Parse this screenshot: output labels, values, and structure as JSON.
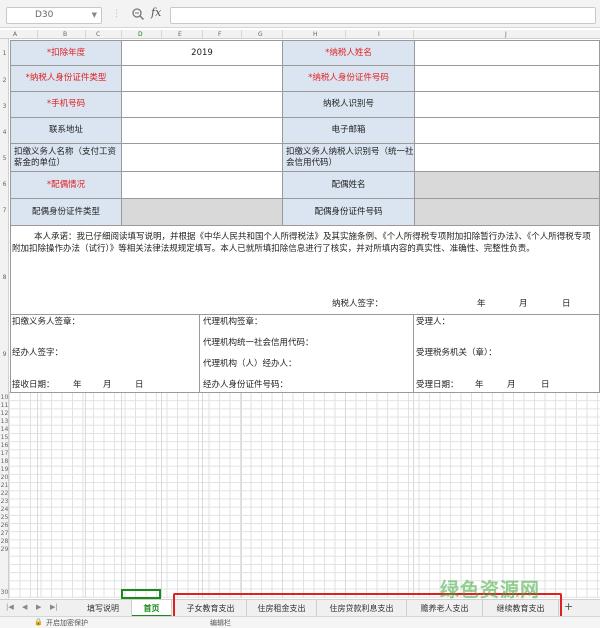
{
  "formula_bar": {
    "cell_ref": "D30",
    "fx_label": "fx",
    "formula_value": ""
  },
  "columns": [
    "A",
    "B",
    "C",
    "D",
    "E",
    "F",
    "G",
    "H",
    "I",
    "J"
  ],
  "rows": [
    "1",
    "2",
    "3",
    "4",
    "5",
    "6",
    "7",
    "8",
    "9",
    "10",
    "11",
    "12",
    "13",
    "14",
    "15",
    "16",
    "17",
    "18",
    "19",
    "20",
    "21",
    "22",
    "23",
    "24",
    "25",
    "26",
    "27",
    "28",
    "29",
    "30"
  ],
  "form": {
    "deduction_year_label": "*扣除年度",
    "deduction_year_value": "2019",
    "taxpayer_name_label": "*纳税人姓名",
    "id_type_label": "*纳税人身份证件类型",
    "id_number_label": "*纳税人身份证件号码",
    "phone_label": "*手机号码",
    "taxpayer_id_label": "纳税人识别号",
    "address_label": "联系地址",
    "email_label": "电子邮箱",
    "withholder_name_label": "扣缴义务人名称（支付工资薪金的单位）",
    "withholder_id_label": "扣缴义务人纳税人识别号（统一社会信用代码）",
    "spouse_status_label": "*配偶情况",
    "spouse_name_label": "配偶姓名",
    "spouse_id_type_label": "配偶身份证件类型",
    "spouse_id_number_label": "配偶身份证件号码",
    "promise_text": "本人承诺：我已仔细阅读填写说明，并根据《中华人民共和国个人所得税法》及其实施条例、《个人所得税专项附加扣除暂行办法》、《个人所得税专项附加扣除操作办法（试行）》等相关法律法规规定填写。本人已就所填扣除信息进行了核实，并对所填内容的真实性、准确性、完整性负责。",
    "taxpayer_signature_label": "纳税人签字：",
    "year_char": "年",
    "month_char": "月",
    "day_char": "日",
    "withholder_seal_label": "扣缴义务人签章：",
    "handler_signature_label": "经办人签字：",
    "receive_date_label": "接收日期：",
    "agent_seal_label": "代理机构签章：",
    "agent_credit_code_label": "代理机构统一社会信用代码：",
    "agent_handler_label": "代理机构（人）经办人：",
    "handler_id_label": "经办人身份证件号码：",
    "acceptor_label": "受理人：",
    "tax_office_label": "受理税务机关（章）：",
    "accept_date_label": "受理日期："
  },
  "tabs": [
    {
      "label": "填写说明",
      "active": false
    },
    {
      "label": "首页",
      "active": true
    },
    {
      "label": "子女教育支出",
      "active": false
    },
    {
      "label": "住房租金支出",
      "active": false
    },
    {
      "label": "住房贷款利息支出",
      "active": false
    },
    {
      "label": "赡养老人支出",
      "active": false
    },
    {
      "label": "继续教育支出",
      "active": false
    }
  ],
  "status": {
    "left_text": "开启加密保护",
    "mid_text": "编辑栏"
  },
  "watermark": {
    "main": "绿色资源网"
  },
  "colors": {
    "label_fill": "#dbe5f1",
    "disabled_fill": "#d9d9d9",
    "required_red": "#e02020",
    "accent_green": "#1a8a1a"
  }
}
